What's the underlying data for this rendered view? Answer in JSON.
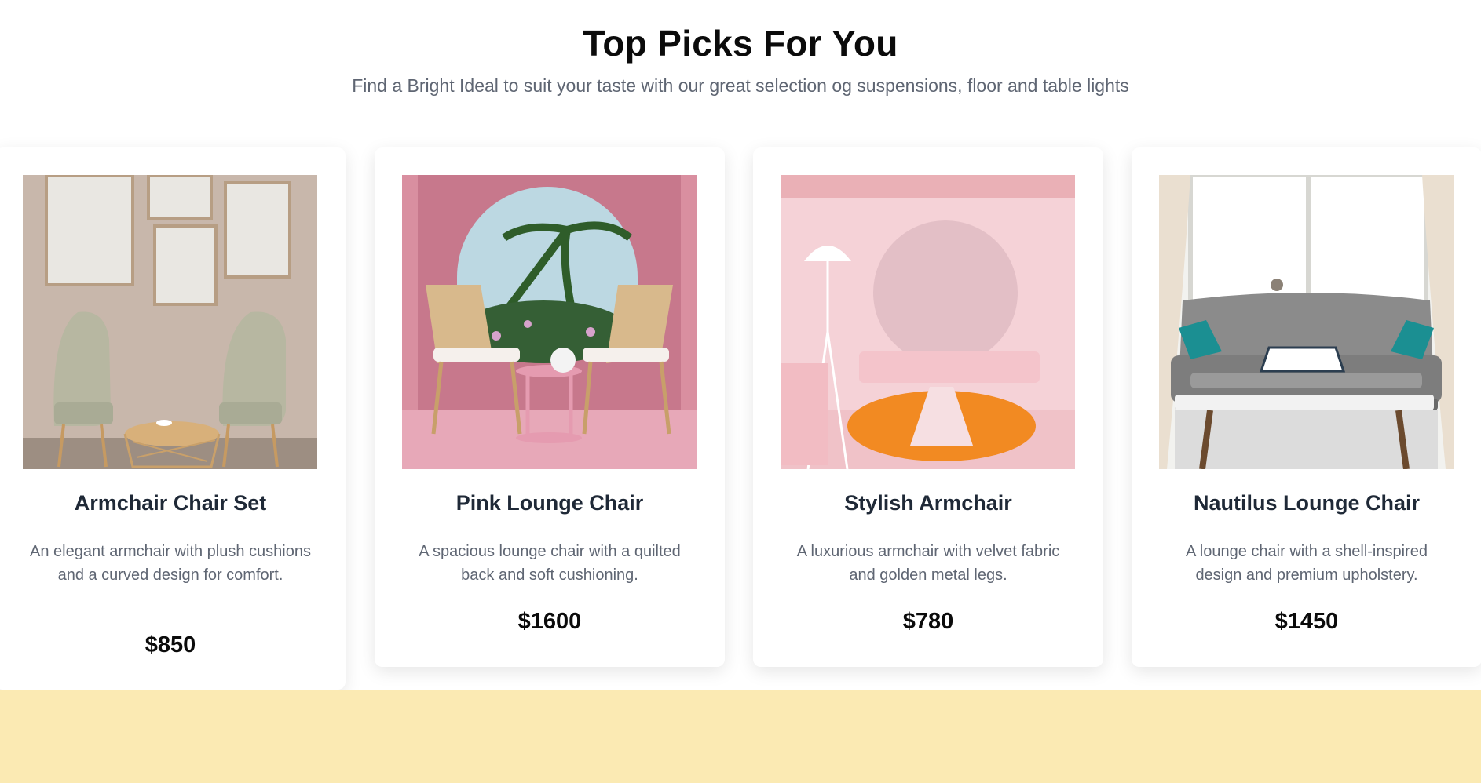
{
  "section": {
    "title": "Top Picks For You",
    "subtitle": "Find a Bright Ideal to suit your taste with our great selection og suspensions, floor and table lights"
  },
  "products": [
    {
      "name": "Armchair Chair Set",
      "description": "An elegant armchair with plush cushions and a curved design for comfort.",
      "price": "$850"
    },
    {
      "name": "Pink Lounge Chair",
      "description": "A spacious lounge chair with a quilted back and soft cushioning.",
      "price": "$1600"
    },
    {
      "name": "Stylish Armchair",
      "description": "A luxurious armchair with velvet fabric and golden metal legs.",
      "price": "$780"
    },
    {
      "name": "Nautilus Lounge Chair",
      "description": "A lounge chair with a shell-inspired design and premium upholstery.",
      "price": "$1450"
    }
  ],
  "colors": {
    "footer_band": "#fbeab3",
    "card_background": "#ffffff"
  }
}
